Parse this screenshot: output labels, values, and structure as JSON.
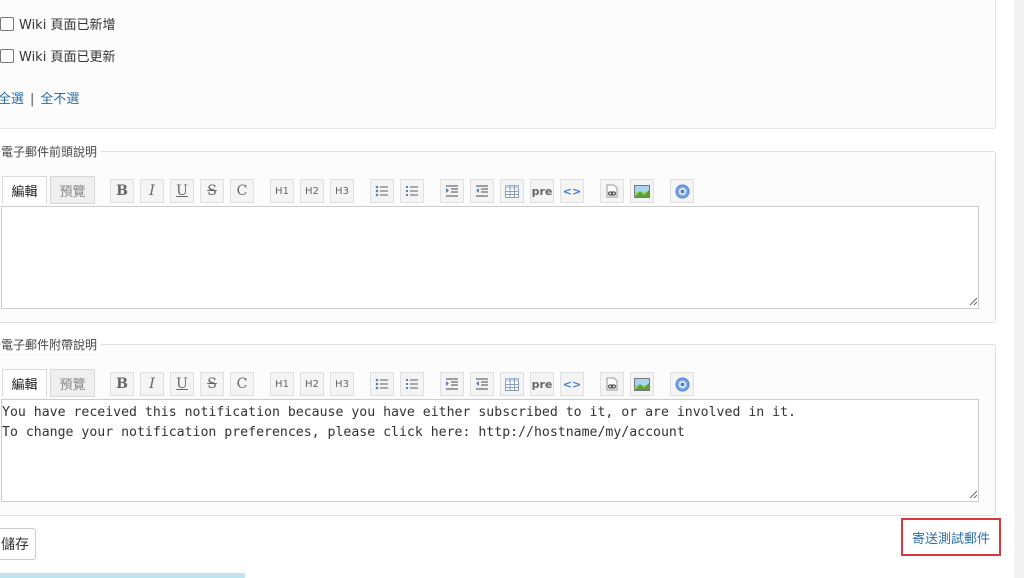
{
  "notifications": {
    "items": [
      {
        "label": "Wiki 頁面已新增",
        "checked": false
      },
      {
        "label": "Wiki 頁面已更新",
        "checked": false
      }
    ],
    "select_all": "全選",
    "separator": "|",
    "select_none": "全不選"
  },
  "header_editor": {
    "legend": "電子郵件前頭說明",
    "tab_edit": "編輯",
    "tab_preview": "預覽",
    "content": ""
  },
  "footer_editor": {
    "legend": "電子郵件附帶說明",
    "tab_edit": "編輯",
    "tab_preview": "預覽",
    "content": "You have received this notification because you have either subscribed to it, or are involved in it.\nTo change your notification preferences, please click here: http://hostname/my/account"
  },
  "toolbar": {
    "bold": "B",
    "italic": "I",
    "underline": "U",
    "strike": "S",
    "code": "C",
    "h1": "H1",
    "h2": "H2",
    "h3": "H3",
    "pre": "pre",
    "inline_code": "<>"
  },
  "actions": {
    "save": "儲存",
    "send_test": "寄送測試郵件"
  }
}
